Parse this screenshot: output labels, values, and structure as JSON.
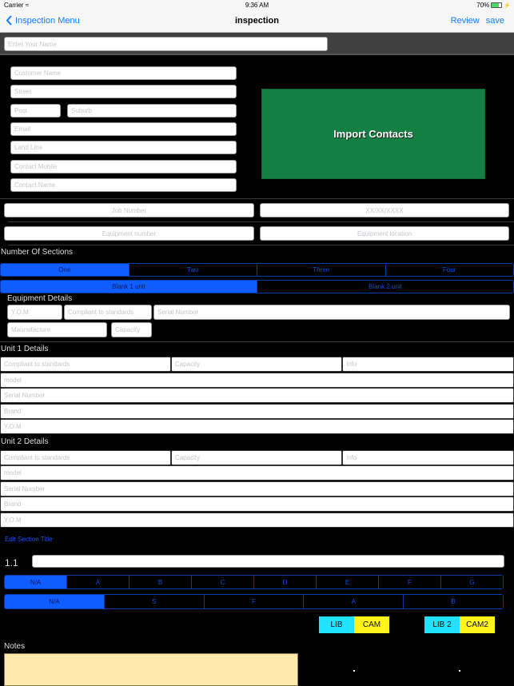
{
  "status_bar": {
    "carrier": "Carrier",
    "time": "9:36 AM",
    "battery": "70%",
    "battery_level": 0.7
  },
  "nav": {
    "back_label": "Inspection Menu",
    "title": "inspection",
    "review_label": "Review",
    "save_label": "save"
  },
  "name_field": {
    "placeholder": "Enter Your Name"
  },
  "customer": {
    "customer_name": "Customer Name",
    "street": "Street",
    "post": "Post",
    "suburb": "Suburb",
    "email": "Email",
    "land_line": "Land Line",
    "contact_mobile": "Contact Mobile",
    "contact_name": "Contact Name",
    "import_label": "Import Contacts"
  },
  "job": {
    "job_number": "Job Number",
    "date": "XX/XX/XXXX",
    "equipment_number": "Equipment number",
    "equipment_location": "Equipment location"
  },
  "sections": {
    "title": "Number Of Sections",
    "options": [
      "One",
      "Two",
      "Three",
      "Four"
    ],
    "selected": "One",
    "units": [
      "Blank 1 unit",
      "Blank 2 unit"
    ],
    "selected_unit": "Blank 1 unit"
  },
  "equipment": {
    "title": "Equipment Details",
    "yom": "Y.O.M",
    "compliant": "Compliant to standards",
    "serial": "Serial Number",
    "manufacture": "Maunufacture",
    "capacity": "Capacity"
  },
  "unit1": {
    "title": "Unit 1 Details",
    "compliant": "Compliant to standards",
    "capacity": "Capacity",
    "info": "Info",
    "model": "model",
    "serial": "Serial Number",
    "brand": "Brand",
    "yom": "Y.O.M"
  },
  "unit2": {
    "title": "Unit 2 Details",
    "compliant": "Compliant to standards",
    "capacity": "Capacity",
    "info": "Info",
    "model": "model",
    "serial": "Serial Number",
    "brand": "Brand",
    "yom": "Y.O.M"
  },
  "section_item": {
    "edit_title_label": "Edit Section Title",
    "number": "1.1",
    "title_value": "",
    "grade_options": [
      "N/A",
      "A",
      "B",
      "C",
      "D",
      "E",
      "F",
      "G"
    ],
    "grade_selected": "N/A",
    "status_options": [
      "N/A",
      "S",
      "F",
      "A",
      "B"
    ],
    "status_selected": "N/A",
    "lib_label": "LIB",
    "cam_label": "CAM",
    "lib2_label": "LIB 2",
    "cam2_label": "CAM2"
  },
  "notes": {
    "title": "Notes",
    "value": ""
  },
  "colors": {
    "accent": "#147efb",
    "segment_on": "#0f5cff",
    "import_green": "#137f42",
    "lib": "#1ee4ff",
    "cam": "#fff41a",
    "notes_bg": "#ffe9ab"
  }
}
